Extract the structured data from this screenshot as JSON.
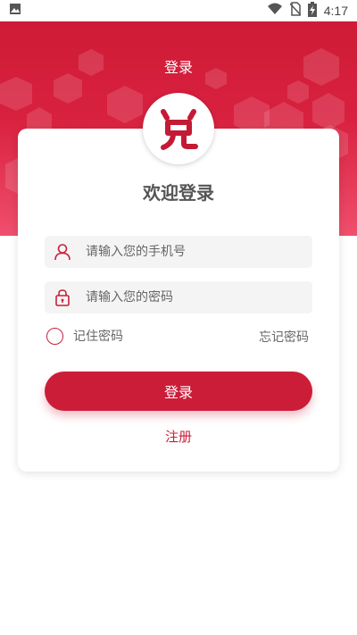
{
  "status_bar": {
    "time": "4:17",
    "icons": [
      "image-icon",
      "wifi-icon",
      "no-sim-icon",
      "battery-charging-icon"
    ]
  },
  "header": {
    "title": "登录"
  },
  "logo": {
    "glyph": "兑",
    "icon": "brand-logo-icon"
  },
  "welcome": "欢迎登录",
  "phone_field": {
    "placeholder": "请输入您的手机号",
    "value": "",
    "icon": "user-icon"
  },
  "password_field": {
    "placeholder": "请输入您的密码",
    "value": "",
    "icon": "lock-icon"
  },
  "remember": {
    "label": "记住密码",
    "checked": false
  },
  "forgot_label": "忘记密码",
  "login_button": "登录",
  "register_link": "注册",
  "colors": {
    "brand": "#cc1d38",
    "hero_top": "#cf1b36",
    "hero_bottom": "#ef4f6d",
    "field_bg": "#f4f4f4"
  }
}
